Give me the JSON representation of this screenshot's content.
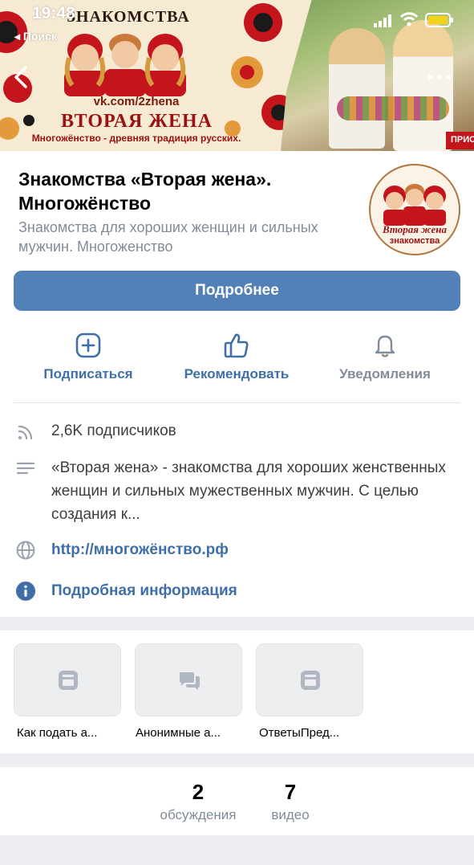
{
  "status_bar": {
    "time": "19:48",
    "back_app": "◂ Поиск"
  },
  "cover": {
    "brand": "ЗНАКОМСТВА",
    "vk_url": "vk.com/2zhena",
    "big_title": "ВТОРАЯ ЖЕНА",
    "tagline": "Многожёнство - древняя традиция русских.",
    "promo": "ПРИС"
  },
  "header": {
    "title": "Знакомства «Вторая жена». Многожёнство",
    "subtitle": "Знакомства для хороших женщин и сильных мужчин. Многоженство",
    "avatar_title": "Вторая жена",
    "avatar_label": "знакомства"
  },
  "more_button": "Подробнее",
  "actions": [
    {
      "label": "Подписаться",
      "icon": "plus-square-icon"
    },
    {
      "label": "Рекомендовать",
      "icon": "thumbs-up-icon"
    },
    {
      "label": "Уведомления",
      "icon": "bell-icon"
    }
  ],
  "info": {
    "followers": "2,6K подписчиков",
    "description": "«Вторая жена» - знакомства для хороших женственных женщин и сильных мужественных мужчин.  С целью создания к...",
    "website": "http://многожёнство.рф",
    "details_link": "Подробная информация"
  },
  "tiles": [
    {
      "label": "Как подать а...",
      "icon": "article-icon"
    },
    {
      "label": "Анонимные а...",
      "icon": "chat-icon"
    },
    {
      "label": "ОтветыПред...",
      "icon": "article-icon"
    }
  ],
  "counters": [
    {
      "value": "2",
      "caption": "обсуждения"
    },
    {
      "value": "7",
      "caption": "видео"
    }
  ],
  "colors": {
    "accent": "#5181b8",
    "link": "#3f6fa8",
    "muted": "#818c99",
    "band": "#ebedf0"
  }
}
